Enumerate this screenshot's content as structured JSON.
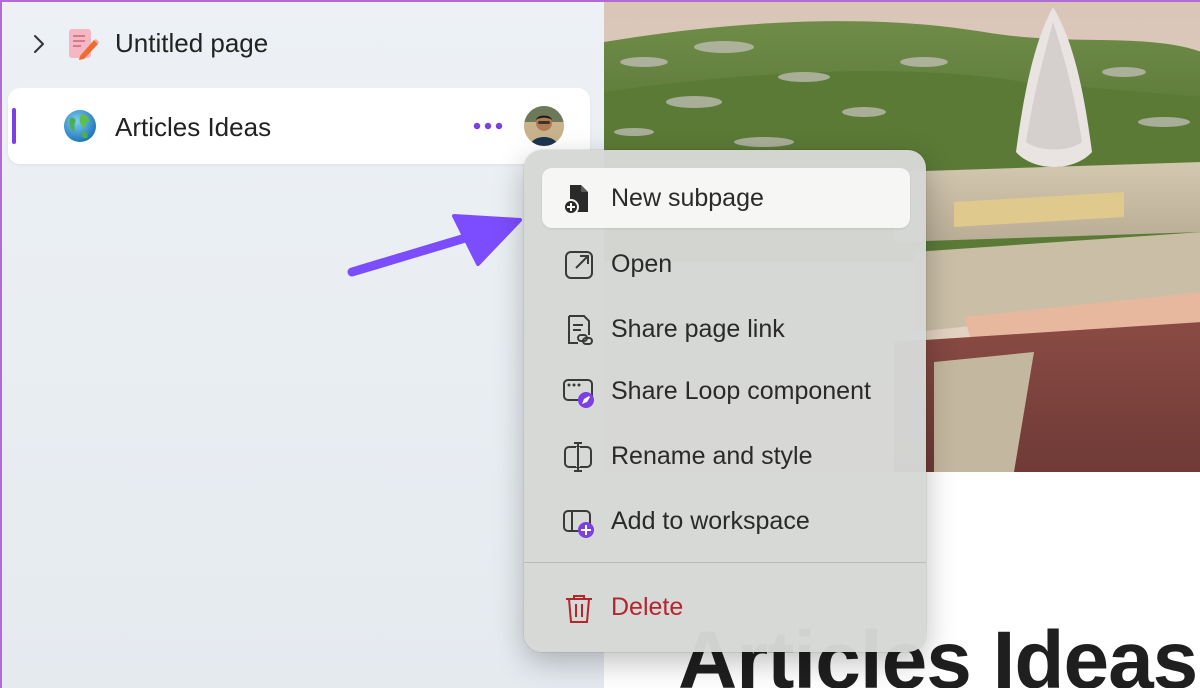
{
  "sidebar": {
    "items": [
      {
        "label": "Untitled page",
        "icon": "page-edit-icon",
        "expandable": true
      },
      {
        "label": "Articles Ideas",
        "icon": "globe-icon",
        "selected": true,
        "more_label": "•••"
      }
    ]
  },
  "context_menu": {
    "items": [
      {
        "label": "New subpage",
        "icon": "new-subpage-icon"
      },
      {
        "label": "Open",
        "icon": "open-external-icon"
      },
      {
        "label": "Share page link",
        "icon": "share-link-icon"
      },
      {
        "label": "Share Loop component",
        "icon": "loop-component-icon"
      },
      {
        "label": "Rename and style",
        "icon": "rename-icon"
      },
      {
        "label": "Add to workspace",
        "icon": "add-workspace-icon"
      },
      {
        "label": "Delete",
        "icon": "trash-icon"
      }
    ]
  },
  "document": {
    "title": "Articles Ideas"
  },
  "colors": {
    "accent": "#7b3fe4",
    "danger": "#b3262e",
    "annotation_arrow": "#7c4dff"
  }
}
